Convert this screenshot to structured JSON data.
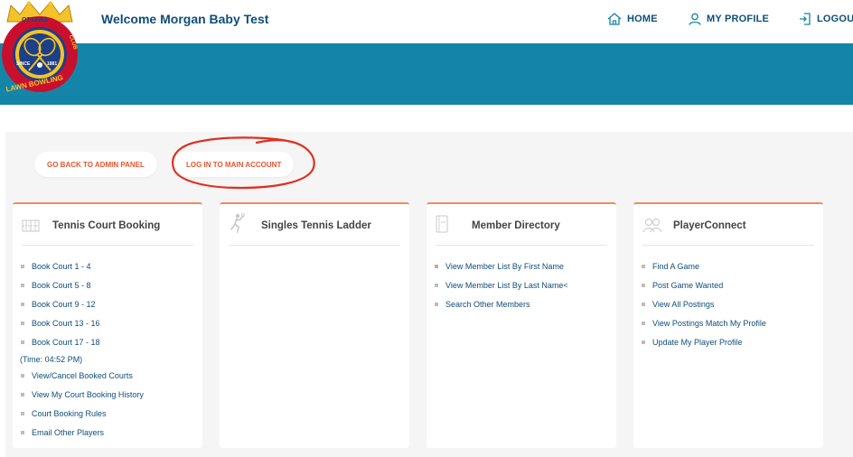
{
  "header": {
    "welcome": "Welcome Morgan Baby Test",
    "nav": [
      {
        "label": "HOME"
      },
      {
        "label": "MY PROFILE"
      },
      {
        "label": "LOGOU"
      }
    ]
  },
  "logo": {
    "top_text": "OTTAWA",
    "since": "SINCE",
    "year": "1881",
    "ring_text": "LAWN BOWLING",
    "ring_right": "CLUB"
  },
  "actions": {
    "back_label": "GO BACK TO ADMIN PANEL",
    "login_label": "LOG IN TO MAIN ACCOUNT"
  },
  "cards": [
    {
      "title": "Tennis Court Booking",
      "icon": "court-icon",
      "items": [
        {
          "label": "Book Court 1 - 4"
        },
        {
          "label": "Book Court 5 - 8"
        },
        {
          "label": "Book Court 9 - 12"
        },
        {
          "label": "Book Court 13 - 16"
        },
        {
          "label": "Book Court 17 - 18"
        }
      ],
      "time": "(Time: 04:52 PM)",
      "items2": [
        {
          "label": "View/Cancel Booked Courts"
        },
        {
          "label": "View My Court Booking History"
        },
        {
          "label": "Court Booking Rules"
        },
        {
          "label": "Email Other Players"
        }
      ]
    },
    {
      "title": "Singles Tennis Ladder",
      "icon": "tennis-player-icon",
      "items": []
    },
    {
      "title": "Member Directory",
      "icon": "directory-book-icon",
      "items": [
        {
          "label": "View Member List By First Name"
        },
        {
          "label": "View Member List By Last Name<"
        },
        {
          "label": "Search Other Members"
        }
      ]
    },
    {
      "title": "PlayerConnect",
      "icon": "players-icon",
      "items": [
        {
          "label": "Find A Game"
        },
        {
          "label": "Post Game Wanted"
        },
        {
          "label": "View All Postings"
        },
        {
          "label": "View Postings Match My Profile"
        },
        {
          "label": "Update My Player Profile"
        }
      ]
    }
  ],
  "colors": {
    "brand_blue": "#1485a8",
    "nav_text": "#0f4d78",
    "accent_orange": "#e8562e",
    "annotation_red": "#e0301e"
  }
}
